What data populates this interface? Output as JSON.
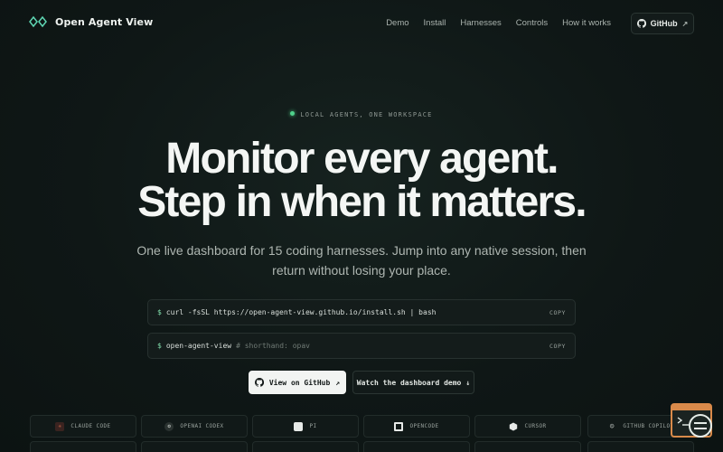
{
  "nav": {
    "brand": "Open Agent View",
    "links": [
      "Demo",
      "Install",
      "Harnesses",
      "Controls",
      "How it works"
    ],
    "github_label": "GitHub",
    "github_arrow": "↗"
  },
  "hero": {
    "eyebrow": "LOCAL AGENTS, ONE WORKSPACE",
    "headline_line1": "Monitor every agent.",
    "headline_line2": "Step in when it matters.",
    "subtitle": "One live dashboard for 15 coding harnesses. Jump into any native session, then return without losing your place."
  },
  "commands": [
    {
      "prompt": "$",
      "text": "curl -fsSL https://open-agent-view.github.io/install.sh | bash",
      "comment": "",
      "copy": "COPY"
    },
    {
      "prompt": "$",
      "text": "open-agent-view",
      "comment": "# shorthand: opav",
      "copy": "COPY"
    }
  ],
  "cta": {
    "primary": "View on GitHub",
    "primary_arrow": "↗",
    "secondary": "Watch the dashboard demo",
    "secondary_arrow": "↓"
  },
  "harnesses": [
    {
      "label": "CLAUDE CODE",
      "icon": "claude-icon",
      "color": "#d26a4a"
    },
    {
      "label": "OPENAI CODEX",
      "icon": "openai-icon",
      "color": "#c9cfcb"
    },
    {
      "label": "PI",
      "icon": "pi-icon",
      "color": "#e6e9e7"
    },
    {
      "label": "OPENCODE",
      "icon": "opencode-icon",
      "color": "#e6e9e7"
    },
    {
      "label": "CURSOR",
      "icon": "cursor-icon",
      "color": "#e6e9e7"
    },
    {
      "label": "GITHUB COPILOT",
      "icon": "copilot-icon",
      "color": "#c9cfcb"
    }
  ],
  "colors": {
    "accent_green": "#4fd18b",
    "background": "#0f1716",
    "corner_accent": "#d98a4a"
  }
}
